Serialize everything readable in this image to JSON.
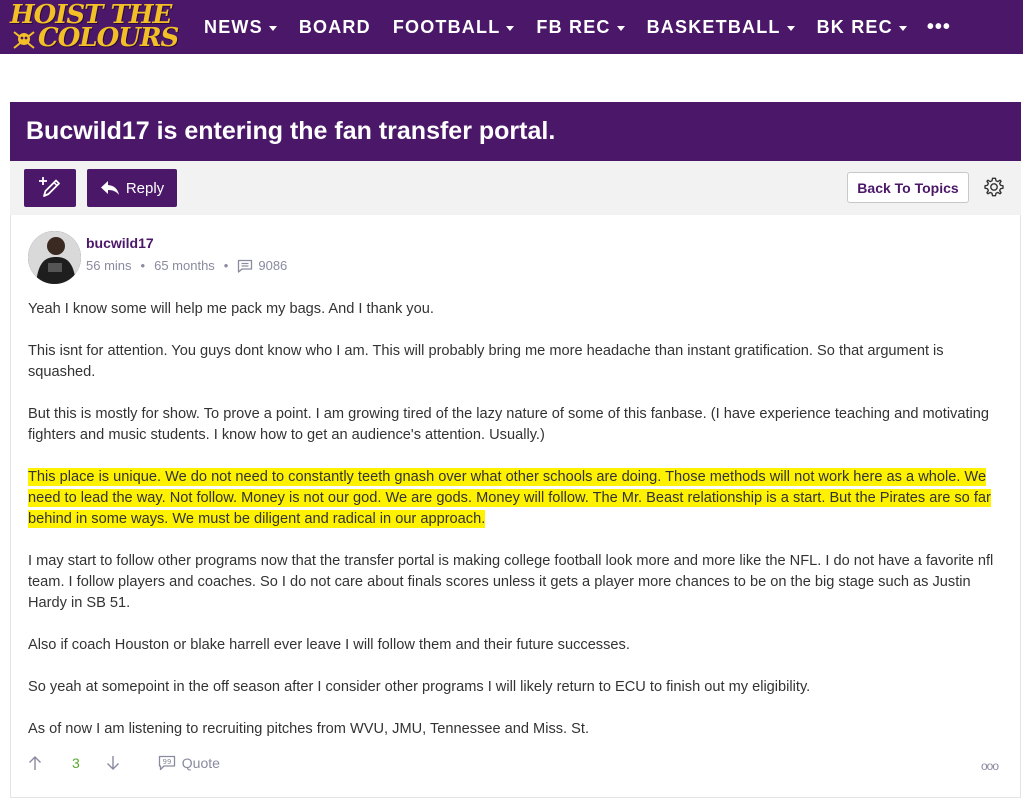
{
  "site": {
    "logo_line1": "HOIST THE",
    "logo_line2": "COLOURS",
    "brand_color": "#4b1869",
    "logo_color": "#f2c026"
  },
  "nav": {
    "items": [
      {
        "label": "NEWS",
        "dropdown": true
      },
      {
        "label": "BOARD",
        "dropdown": false
      },
      {
        "label": "FOOTBALL",
        "dropdown": true
      },
      {
        "label": "FB REC",
        "dropdown": true
      },
      {
        "label": "BASKETBALL",
        "dropdown": true
      },
      {
        "label": "BK REC",
        "dropdown": true
      }
    ],
    "more_label": "•••"
  },
  "topic": {
    "title": "Bucwild17 is entering the fan transfer portal."
  },
  "toolbar": {
    "reply_label": "Reply",
    "back_label": "Back To Topics"
  },
  "post": {
    "author": "bucwild17",
    "time_ago": "56 mins",
    "member_for": "65 months",
    "post_count": "9086",
    "paragraphs": [
      {
        "text": "Yeah I know some will help me pack my bags. And I thank you.",
        "highlight": false
      },
      {
        "text": "This isnt for attention. You guys dont know who I am. This will probably bring me more headache than instant gratification. So that argument is squashed.",
        "highlight": false
      },
      {
        "text": "But this is mostly for show. To prove a point. I am growing tired of the lazy nature of some of this fanbase. (I have experience teaching and motivating fighters and music students. I know how to get an audience's attention. Usually.)",
        "highlight": false
      },
      {
        "text": "This place is unique. We do not need to constantly teeth gnash over what other schools are doing. Those methods will not work here as a whole. We need to lead the way. Not follow. Money is not our god. We are gods. Money will follow. The Mr. Beast relationship is a start. But the Pirates are so far behind in some ways. We must be diligent and radical in our approach.",
        "highlight": true
      },
      {
        "text": "I may start to follow other programs now that the transfer portal is making college football look more and more like the NFL. I do not have a favorite nfl team. I follow players and coaches. So I do not care about finals scores unless it gets a player more chances to be on the big stage such as Justin Hardy in SB 51.",
        "highlight": false
      },
      {
        "text": "Also if coach Houston or blake harrell ever leave I will follow them and their future successes.",
        "highlight": false
      },
      {
        "text": "So yeah at somepoint in the off season after I consider other programs I will likely return to ECU to finish out my eligibility.",
        "highlight": false
      },
      {
        "text": "As of now I am listening to recruiting pitches from WVU, JMU, Tennessee and Miss. St.",
        "highlight": false
      }
    ],
    "vote_score": "3",
    "quote_label": "Quote",
    "more_label": "ooo",
    "highlight_color": "#fff200"
  }
}
